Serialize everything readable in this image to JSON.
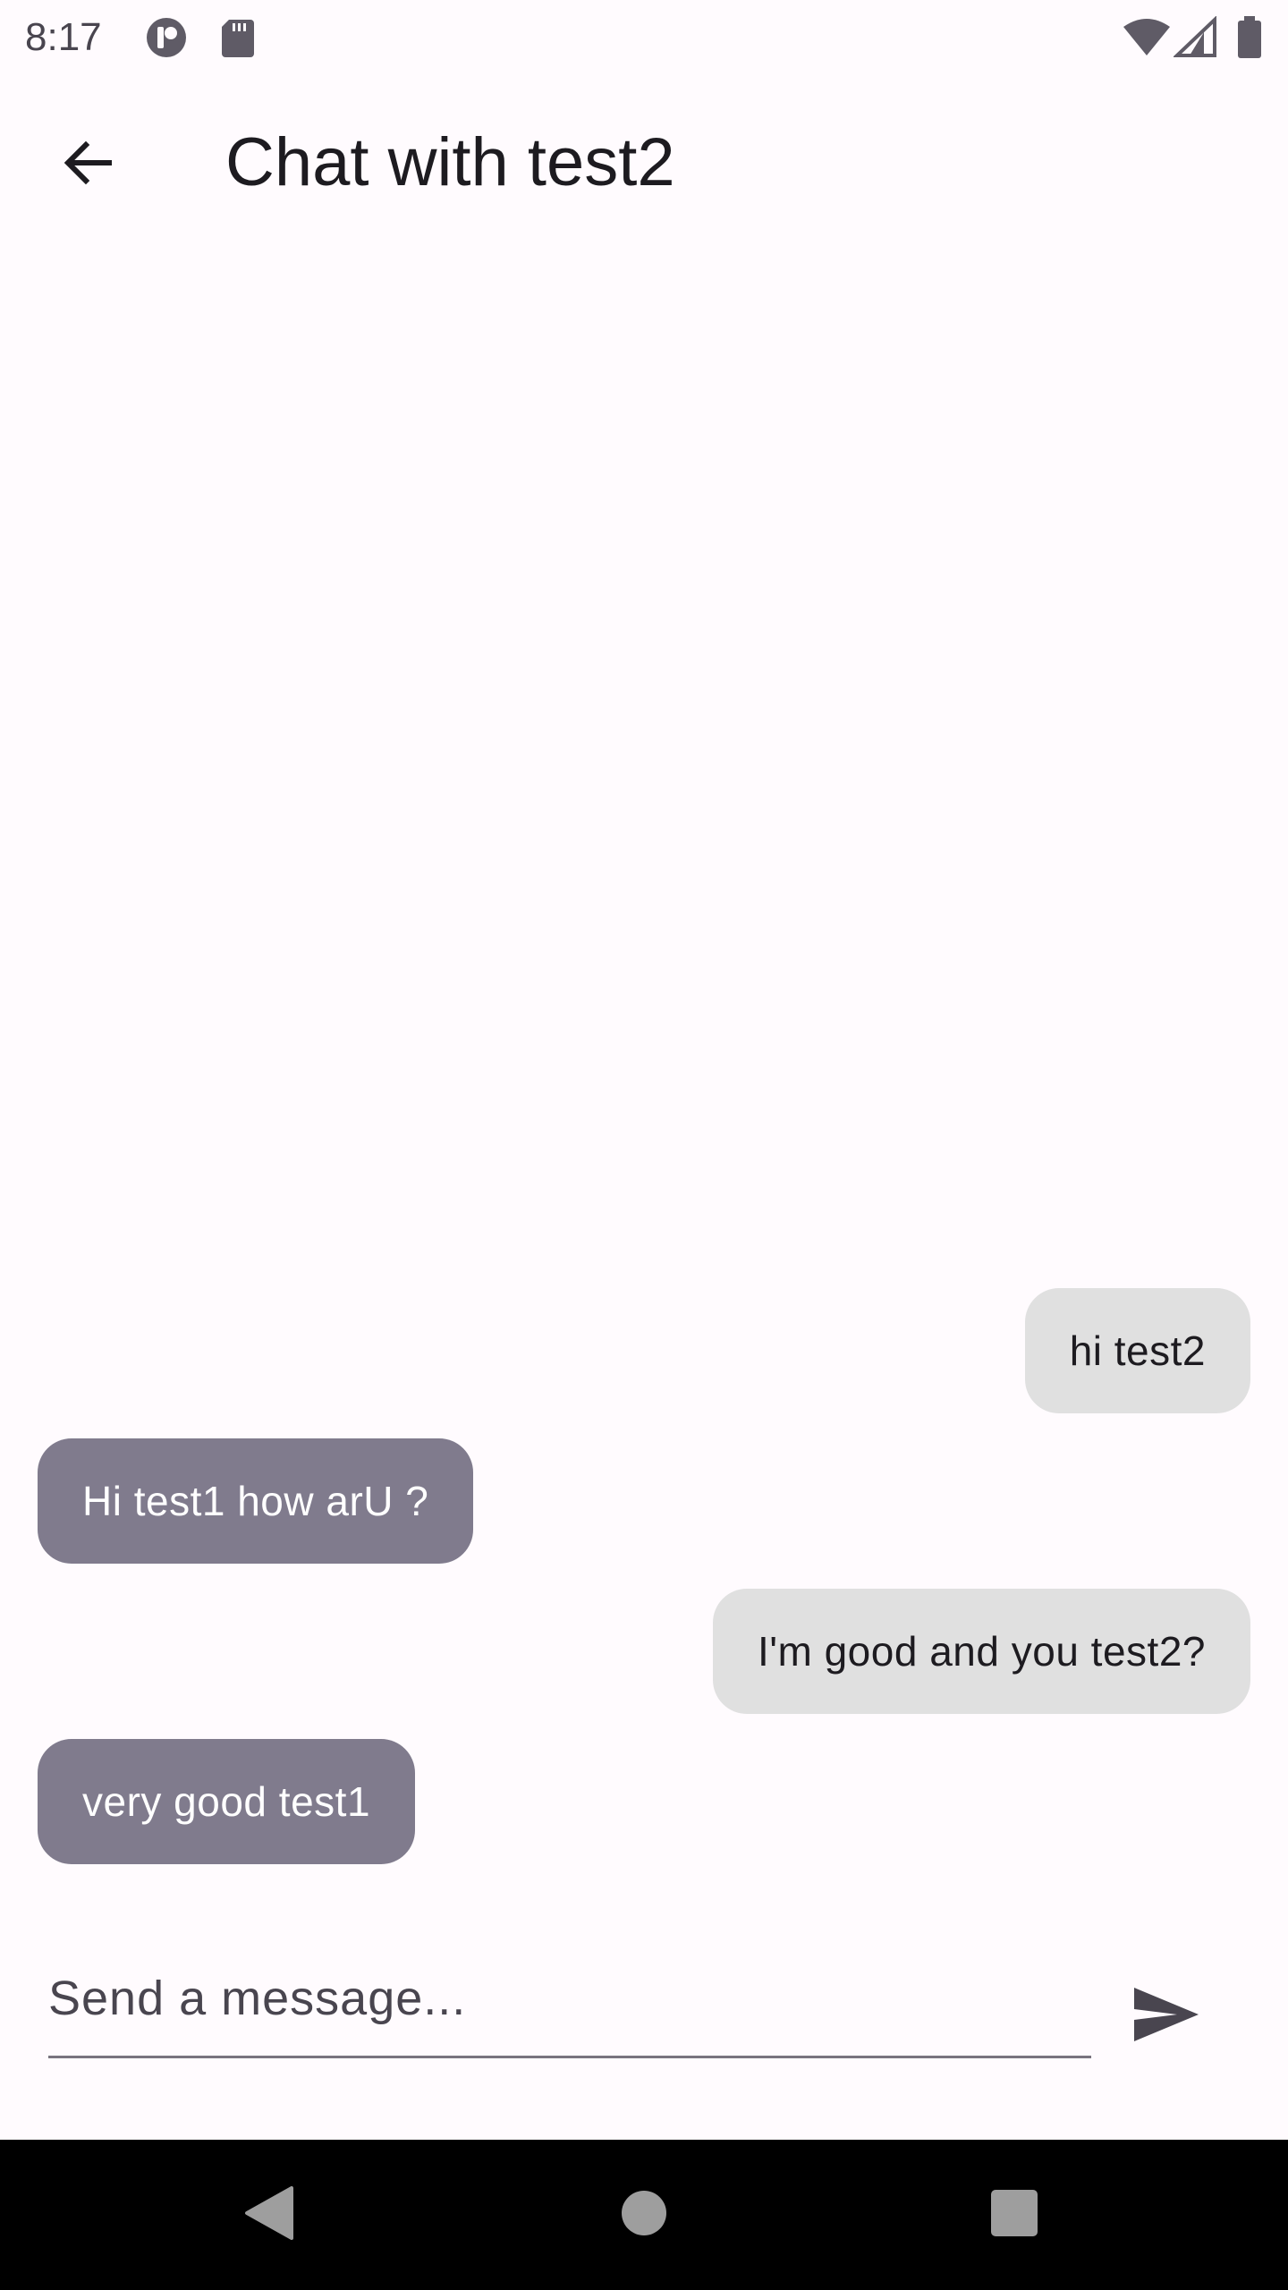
{
  "status_bar": {
    "time": "8:17",
    "icons": [
      "app-notification-icon",
      "sd-card-icon",
      "wifi-icon",
      "cellular-signal-icon",
      "battery-icon"
    ]
  },
  "app_bar": {
    "title": "Chat with test2",
    "back_icon": "arrow-back-icon"
  },
  "messages": [
    {
      "text": "hi test2",
      "direction": "sent"
    },
    {
      "text": "Hi test1 how arU ?",
      "direction": "received"
    },
    {
      "text": "I'm good and you test2?",
      "direction": "sent"
    },
    {
      "text": "very good test1",
      "direction": "received"
    }
  ],
  "composer": {
    "placeholder": "Send a message...",
    "value": "",
    "send_icon": "send-icon"
  },
  "nav_bar": {
    "icons": [
      "back-triangle-icon",
      "home-circle-icon",
      "recents-square-icon"
    ]
  },
  "colors": {
    "background": "#fffbfe",
    "sent_bubble": "#e0e0e0",
    "received_bubble": "#807b8d",
    "nav_bar": "#000000"
  }
}
